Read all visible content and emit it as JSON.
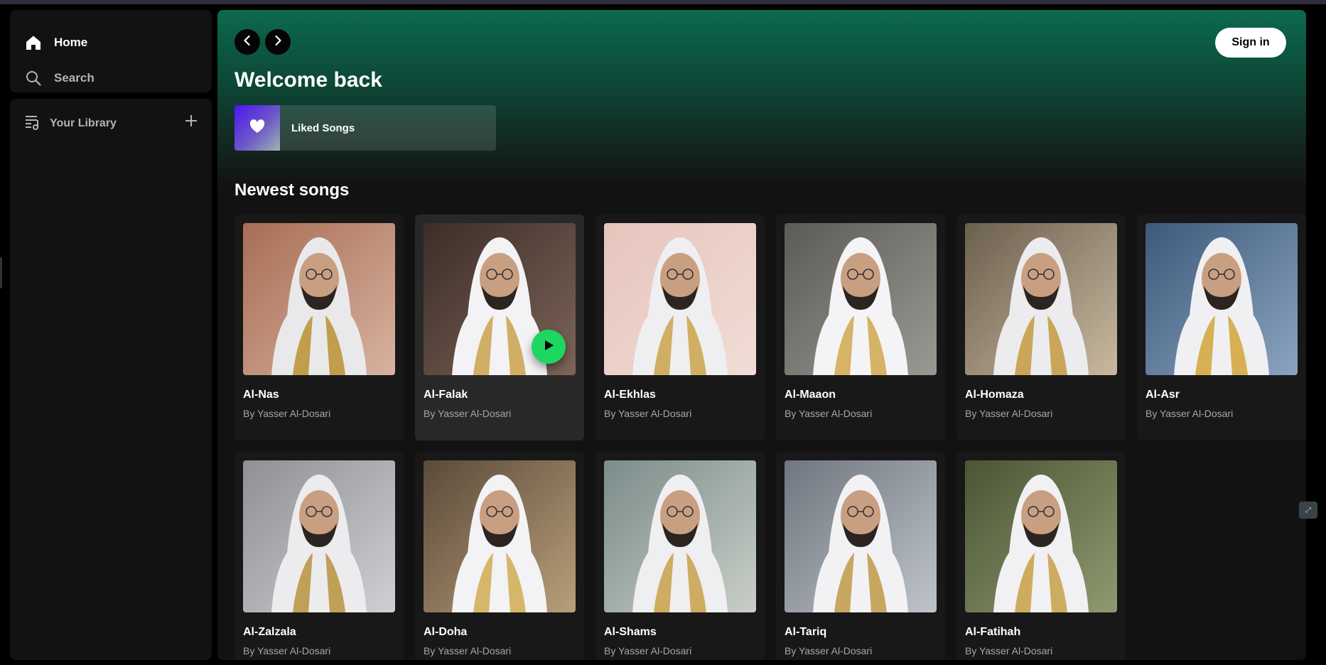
{
  "nav": {
    "home_label": "Home",
    "search_label": "Search",
    "home_icon": "home-icon",
    "search_icon": "search-icon"
  },
  "library": {
    "label": "Your Library",
    "icon": "library-icon",
    "add_icon": "plus-icon"
  },
  "header": {
    "back_icon": "chevron-left-icon",
    "forward_icon": "chevron-right-icon",
    "sign_in_label": "Sign in"
  },
  "welcome": {
    "title": "Welcome back",
    "liked_songs_label": "Liked Songs",
    "liked_icon": "heart-icon"
  },
  "newest": {
    "title": "Newest songs",
    "items": [
      {
        "title": "Al-Nas",
        "subtitle": "By Yasser Al-Dosari"
      },
      {
        "title": "Al-Falak",
        "subtitle": "By Yasser Al-Dosari"
      },
      {
        "title": "Al-Ekhlas",
        "subtitle": "By Yasser Al-Dosari"
      },
      {
        "title": "Al-Maaon",
        "subtitle": "By Yasser Al-Dosari"
      },
      {
        "title": "Al-Homaza",
        "subtitle": "By Yasser Al-Dosari"
      },
      {
        "title": "Al-Asr",
        "subtitle": "By Yasser Al-Dosari"
      },
      {
        "title": "Al-Zalzala",
        "subtitle": "By Yasser Al-Dosari"
      },
      {
        "title": "Al-Doha",
        "subtitle": "By Yasser Al-Dosari"
      },
      {
        "title": "Al-Shams",
        "subtitle": "By Yasser Al-Dosari"
      },
      {
        "title": "Al-Tariq",
        "subtitle": "By Yasser Al-Dosari"
      },
      {
        "title": "Al-Fatihah",
        "subtitle": "By Yasser Al-Dosari"
      }
    ]
  },
  "colors": {
    "accent_green": "#1ed760",
    "header_gradient_top": "#0c6a4e",
    "panel_bg": "#121212",
    "card_bg": "#181818"
  }
}
